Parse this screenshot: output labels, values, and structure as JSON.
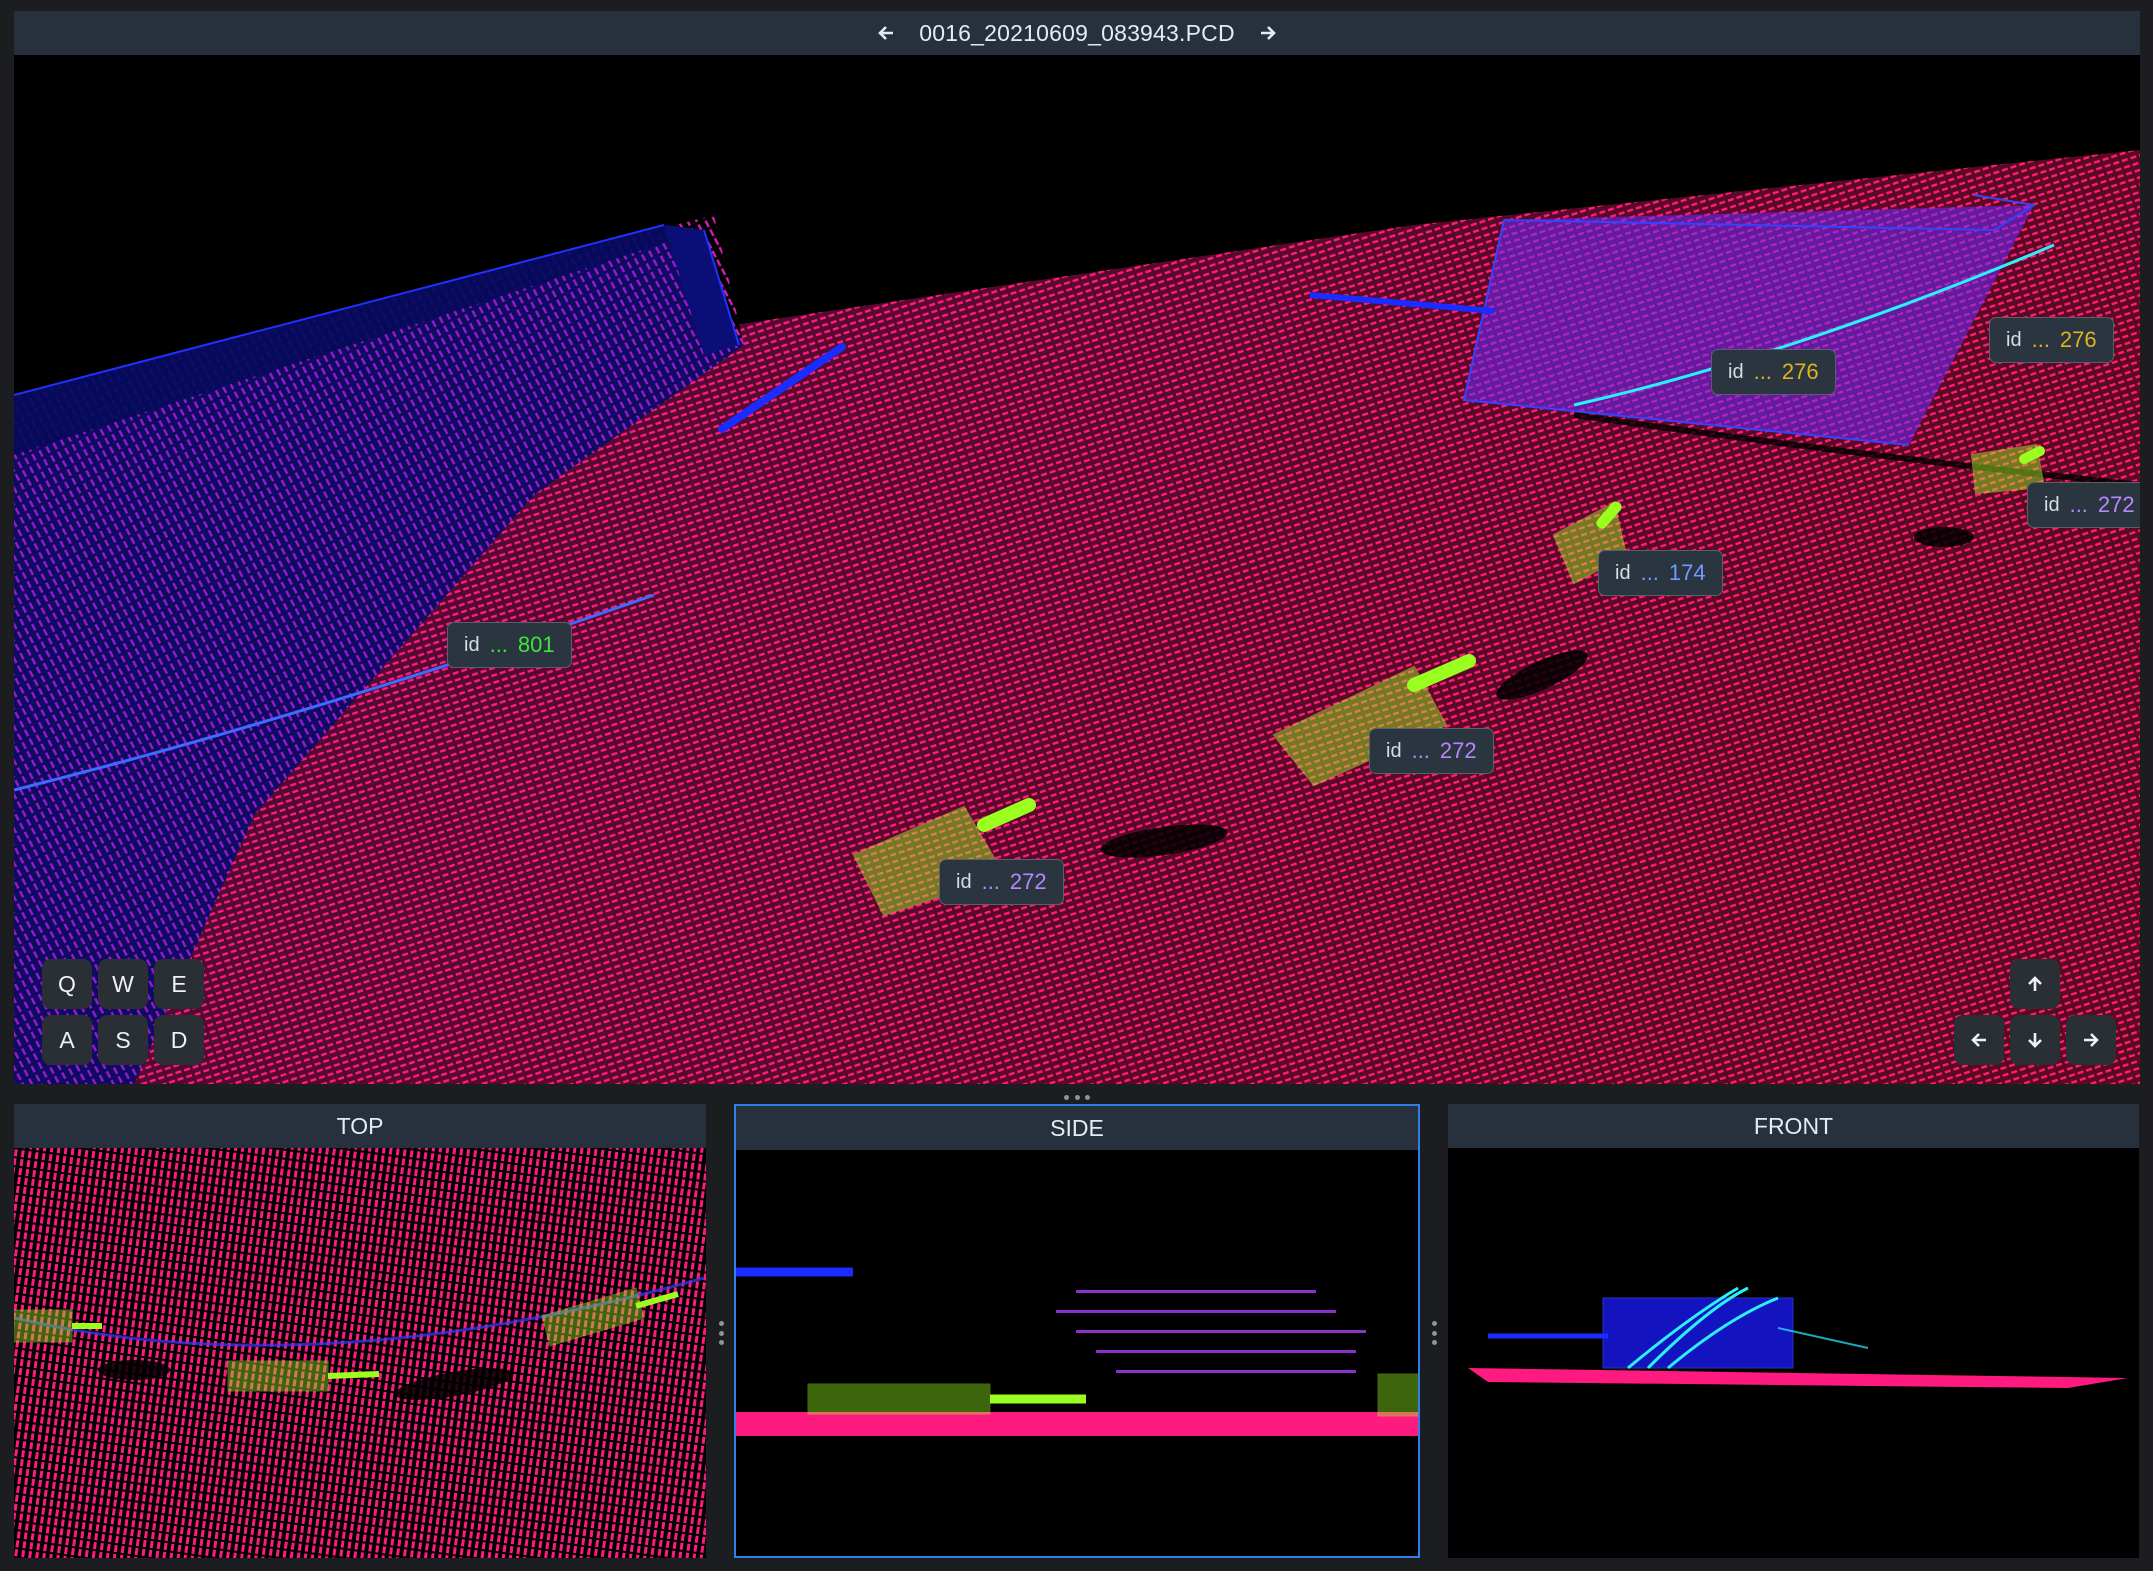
{
  "header": {
    "filename": "0016_20210609_083943.PCD",
    "prev_icon": "arrow-left-icon",
    "next_icon": "arrow-right-icon"
  },
  "labels": [
    {
      "id": "801",
      "prefix": "id",
      "ellipsis": "...",
      "color": "#3ee33e"
    },
    {
      "id": "276",
      "prefix": "id",
      "ellipsis": "...",
      "color": "#e0b21d"
    },
    {
      "id": "276",
      "prefix": "id",
      "ellipsis": "...",
      "color": "#e0b21d"
    },
    {
      "id": "272",
      "prefix": "id",
      "ellipsis": "...",
      "color": "#b687ff"
    },
    {
      "id": "174",
      "prefix": "id",
      "ellipsis": "...",
      "color": "#6d9bff"
    },
    {
      "id": "272",
      "prefix": "id",
      "ellipsis": "...",
      "color": "#b687ff"
    },
    {
      "id": "272",
      "prefix": "id",
      "ellipsis": "...",
      "color": "#b687ff"
    }
  ],
  "keys": {
    "row1": [
      "Q",
      "W",
      "E"
    ],
    "row2": [
      "A",
      "S",
      "D"
    ]
  },
  "arrows": {
    "up": "arrow-up-icon",
    "left": "arrow-left-icon",
    "down": "arrow-down-icon",
    "right": "arrow-right-icon"
  },
  "panels": {
    "top": "TOP",
    "side": "SIDE",
    "front": "FRONT"
  },
  "colors": {
    "ground": "#ff1a7a",
    "wall": "#1a1aff",
    "box": "#9aff1f",
    "panel_header": "#27313d",
    "active_border": "#2f7fe6"
  }
}
